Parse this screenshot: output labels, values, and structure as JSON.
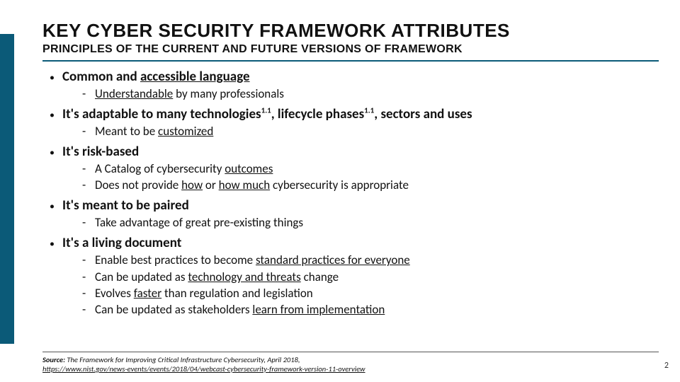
{
  "header": {
    "title": "KEY CYBER SECURITY FRAMEWORK ATTRIBUTES",
    "subtitle": "PRINCIPLES OF THE CURRENT AND FUTURE VERSIONS OF FRAMEWORK"
  },
  "bullets": [
    {
      "head_html": "Common and <span class='u'>accessible language</span>",
      "subs": [
        "<span class='u'>Understandable</span> by many professionals"
      ]
    },
    {
      "head_html": "It's adaptable to many technologies<sup>1.1</sup>, lifecycle phases<sup>1.1</sup>, sectors and uses",
      "subs": [
        "Meant to be <span class='u'>customized</span>"
      ]
    },
    {
      "head_html": "It's risk-based",
      "subs": [
        "A Catalog of cybersecurity <span class='u'>outcomes</span>",
        "Does not provide <span class='u'>how</span> or <span class='u'>how much</span> cybersecurity is appropriate"
      ]
    },
    {
      "head_html": "It's meant to be paired",
      "subs": [
        "Take advantage of great pre-existing things"
      ]
    },
    {
      "head_html": "It's a living document",
      "subs": [
        "Enable best practices to become <span class='u'>standard practices for everyone</span>",
        "Can be updated as <span class='u'>technology and threats</span> change",
        "Evolves <span class='u'>faster</span> than regulation and legislation",
        "Can be updated as stakeholders <span class='u'>learn from implementation</span>"
      ]
    }
  ],
  "footer": {
    "source_label": "Source:",
    "source_text": "The Framework for Improving Critical Infrastructure Cybersecurity, April 2018,",
    "source_url": "https://www.nist.gov/news-events/events/2018/04/webcast-cybersecurity-framework-version-11-overview"
  },
  "page_number": "2"
}
